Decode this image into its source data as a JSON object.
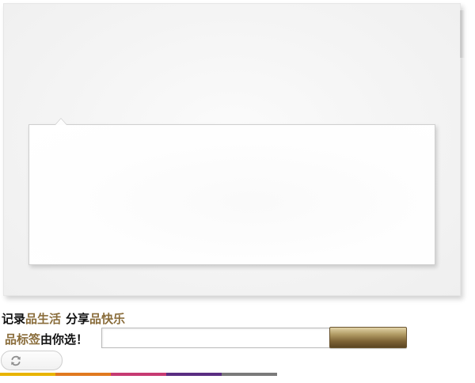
{
  "slogan": {
    "part1": "记录",
    "part2": "品生活",
    "part3": "分享",
    "part4": "品快乐"
  },
  "tag_form": {
    "label_gold": "品标签",
    "label_rest": "由你选！",
    "input_value": "",
    "input_placeholder": "",
    "submit_label": ""
  },
  "refresh": {
    "icon": "refresh-icon"
  },
  "colors": {
    "accent_gold": "#8a6d3b",
    "strip": [
      "#e8b400",
      "#e0791f",
      "#c63a72",
      "#5a2d82",
      "#7a7a7a"
    ]
  }
}
